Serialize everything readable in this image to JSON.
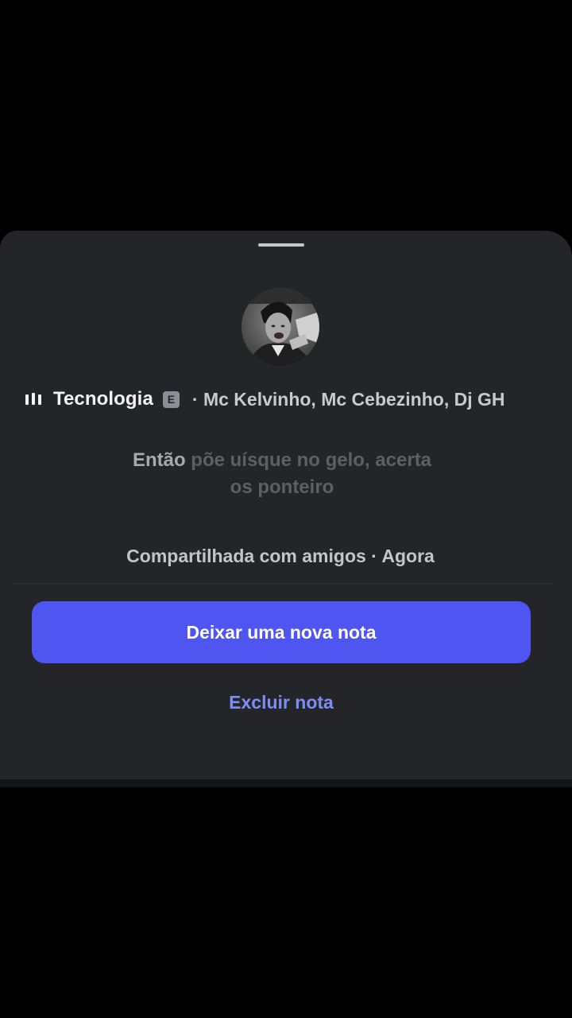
{
  "colors": {
    "sheet_background": "#242529",
    "accent": "#4e55f0",
    "link": "#7b8ef5"
  },
  "note": {
    "avatar_icon": "profile-avatar",
    "song": {
      "icon": "audio-bars-icon",
      "title": "Tecnologia",
      "explicit_badge": "E",
      "artists": "· Mc Kelvinho, Mc Cebezinho, Dj GH"
    },
    "lyric": {
      "active_word": "Então",
      "rest_line1": "põe uísque no gelo, acerta",
      "line2": "os ponteiro"
    },
    "meta": "Compartilhada com amigos · Agora"
  },
  "actions": {
    "primary_label": "Deixar uma nova nota",
    "delete_label": "Excluir nota"
  }
}
